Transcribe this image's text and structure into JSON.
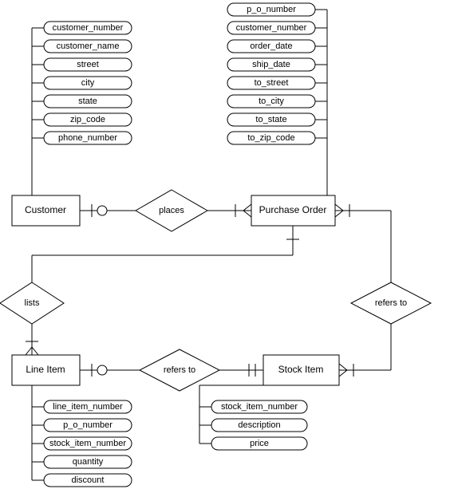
{
  "entities": {
    "customer": {
      "name": "Customer",
      "attributes": [
        "customer_number",
        "customer_name",
        "street",
        "city",
        "state",
        "zip_code",
        "phone_number"
      ]
    },
    "purchase_order": {
      "name": "Purchase Order",
      "attributes": [
        "p_o_number",
        "customer_number",
        "order_date",
        "ship_date",
        "to_street",
        "to_city",
        "to_state",
        "to_zip_code"
      ]
    },
    "line_item": {
      "name": "Line Item",
      "attributes": [
        "line_item_number",
        "p_o_number",
        "stock_item_number",
        "quantity",
        "discount"
      ]
    },
    "stock_item": {
      "name": "Stock Item",
      "attributes": [
        "stock_item_number",
        "description",
        "price"
      ]
    }
  },
  "relationships": {
    "places": "places",
    "lists": "lists",
    "refers_to_1": "refers to",
    "refers_to_2": "refers to"
  }
}
